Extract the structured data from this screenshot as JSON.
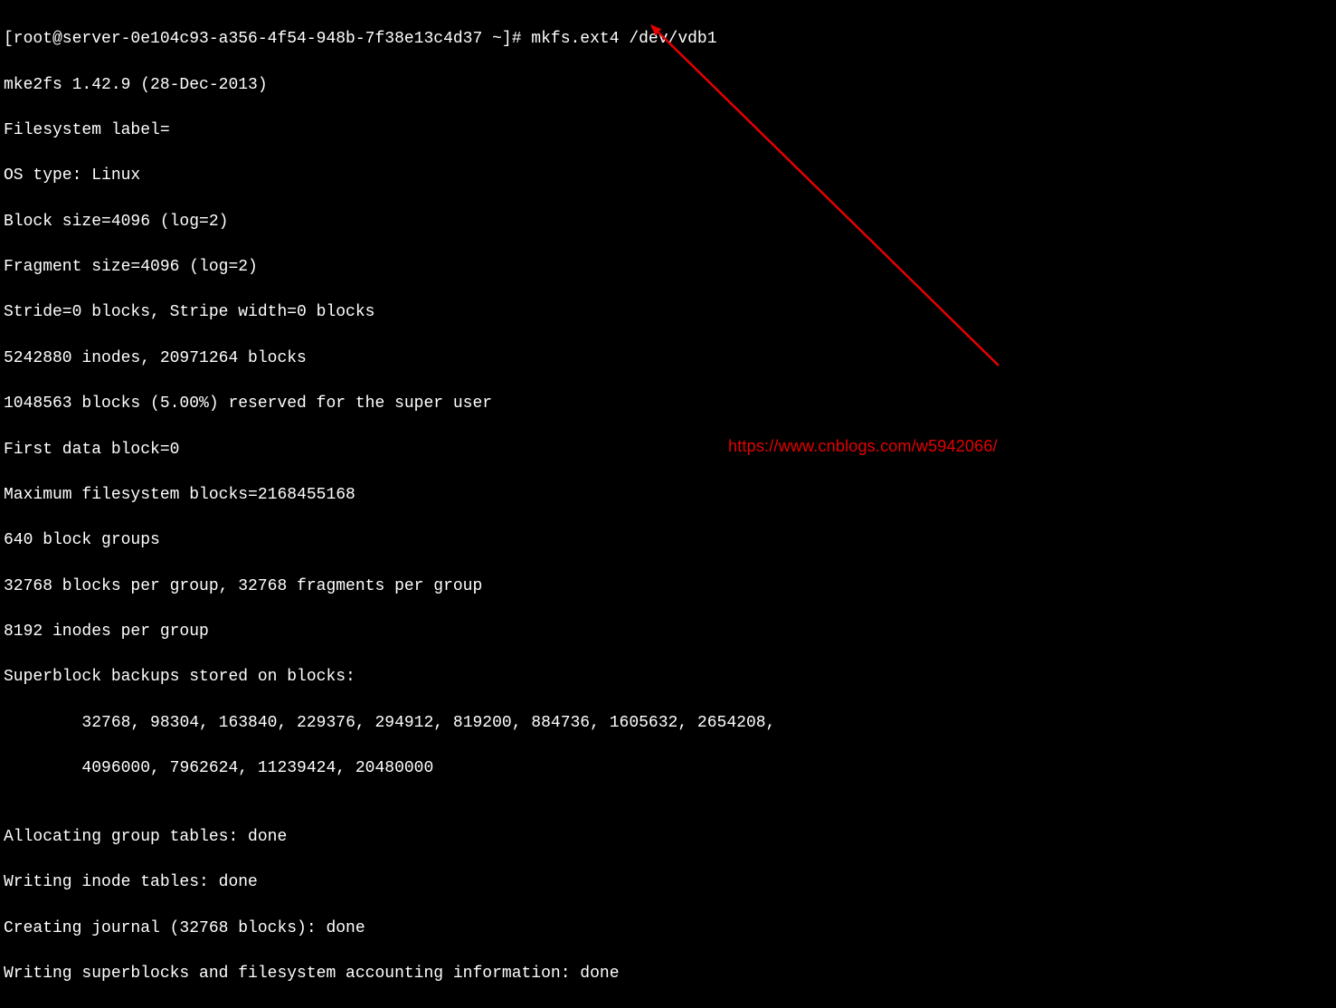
{
  "terminal": {
    "prompt": "[root@server-0e104c93-a356-4f54-948b-7f38e13c4d37 ~]# ",
    "command": "mkfs.ext4 /dev/vdb1",
    "output": {
      "line01": "mke2fs 1.42.9 (28-Dec-2013)",
      "line02": "Filesystem label=",
      "line03": "OS type: Linux",
      "line04": "Block size=4096 (log=2)",
      "line05": "Fragment size=4096 (log=2)",
      "line06": "Stride=0 blocks, Stripe width=0 blocks",
      "line07": "5242880 inodes, 20971264 blocks",
      "line08": "1048563 blocks (5.00%) reserved for the super user",
      "line09": "First data block=0",
      "line10": "Maximum filesystem blocks=2168455168",
      "line11": "640 block groups",
      "line12": "32768 blocks per group, 32768 fragments per group",
      "line13": "8192 inodes per group",
      "line14": "Superblock backups stored on blocks: ",
      "line15": "\t32768, 98304, 163840, 229376, 294912, 819200, 884736, 1605632, 2654208, ",
      "line16": "\t4096000, 7962624, 11239424, 20480000",
      "line17": "",
      "line18": "Allocating group tables: done                            ",
      "line19": "Writing inode tables: done                            ",
      "line20": "Creating journal (32768 blocks): done",
      "line21": "Writing superblocks and filesystem accounting information: done "
    }
  },
  "annotation": {
    "watermark_url": "https://www.cnblogs.com/w5942066/",
    "arrow_color": "#e60000"
  }
}
